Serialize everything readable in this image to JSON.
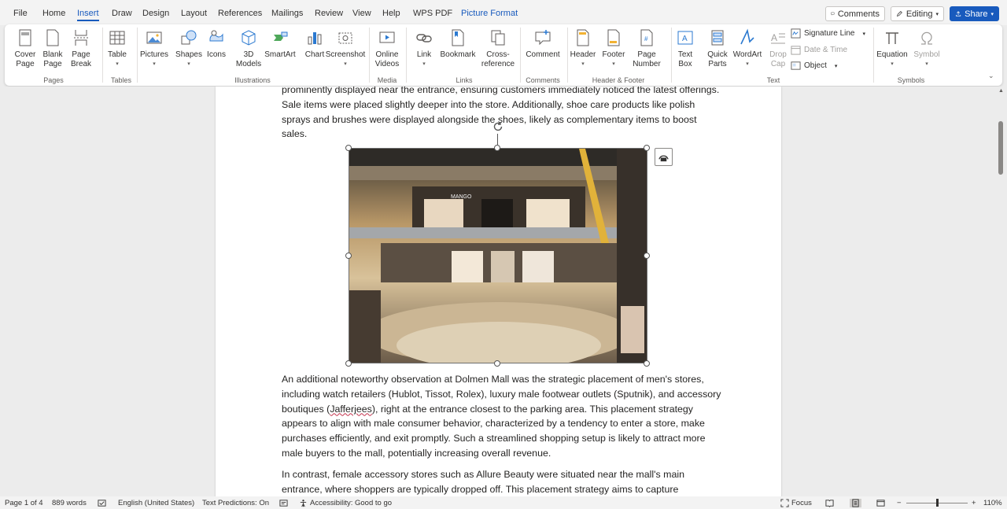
{
  "menu": {
    "tabs": [
      "File",
      "Home",
      "Insert",
      "Draw",
      "Design",
      "Layout",
      "References",
      "Mailings",
      "Review",
      "View",
      "Help",
      "WPS PDF"
    ],
    "context_tab": "Picture Format",
    "active_tab": "Insert",
    "comments_label": "Comments",
    "editing_label": "Editing",
    "share_label": "Share"
  },
  "ribbon": {
    "pages": {
      "group": "Pages",
      "cover_page": "Cover\nPage",
      "blank_page": "Blank\nPage",
      "page_break": "Page\nBreak"
    },
    "tables": {
      "group": "Tables",
      "table": "Table"
    },
    "illustrations": {
      "group": "Illustrations",
      "pictures": "Pictures",
      "shapes": "Shapes",
      "icons": "Icons",
      "models_3d": "3D\nModels",
      "smartart": "SmartArt",
      "chart": "Chart",
      "screenshot": "Screenshot"
    },
    "media": {
      "group": "Media",
      "online_videos": "Online\nVideos"
    },
    "links": {
      "group": "Links",
      "link": "Link",
      "bookmark": "Bookmark",
      "cross_reference": "Cross-\nreference"
    },
    "comments": {
      "group": "Comments",
      "comment": "Comment"
    },
    "header_footer": {
      "group": "Header & Footer",
      "header": "Header",
      "footer": "Footer",
      "page_number": "Page\nNumber"
    },
    "text": {
      "group": "Text",
      "text_box": "Text\nBox",
      "quick_parts": "Quick\nParts",
      "wordart": "WordArt",
      "drop_cap": "Drop\nCap",
      "signature_line": "Signature Line",
      "date_time": "Date & Time",
      "object": "Object"
    },
    "symbols": {
      "group": "Symbols",
      "equation": "Equation",
      "symbol": "Symbol"
    }
  },
  "document": {
    "para1": "prominently displayed near the entrance, ensuring customers immediately noticed the latest offerings. Sale items were placed slightly deeper into the store. Additionally, shoe care products like polish sprays and brushes were displayed alongside the shoes, likely as complementary items to boost sales.",
    "image_store_sign": "MANGO",
    "para2_a": "An additional noteworthy observation at Dolmen Mall was the strategic placement of men's stores, including watch retailers (Hublot, Tissot, Rolex), luxury male footwear outlets (Sputnik), and accessory boutiques (",
    "para2_misspelled": "Jafferjees",
    "para2_b": "), right at the entrance closest to the parking area. This placement strategy appears to align with male consumer behavior, characterized by a tendency to enter a store, make purchases efficiently, and exit promptly. Such a streamlined shopping setup is likely to attract more male buyers to the mall, potentially increasing overall revenue.",
    "para3": "In contrast, female accessory stores such as Allure Beauty were situated near the mall's main entrance, where shoppers are typically dropped off. This placement strategy aims to capture"
  },
  "status": {
    "page": "Page 1 of 4",
    "words": "889 words",
    "language": "English (United States)",
    "text_predictions": "Text Predictions: On",
    "accessibility": "Accessibility: Good to go",
    "focus": "Focus",
    "zoom": "110%"
  },
  "colors": {
    "accent": "#185abd",
    "ribbon_bg": "#ffffff",
    "app_bg": "#ececec",
    "spell_error": "#c4314b"
  }
}
